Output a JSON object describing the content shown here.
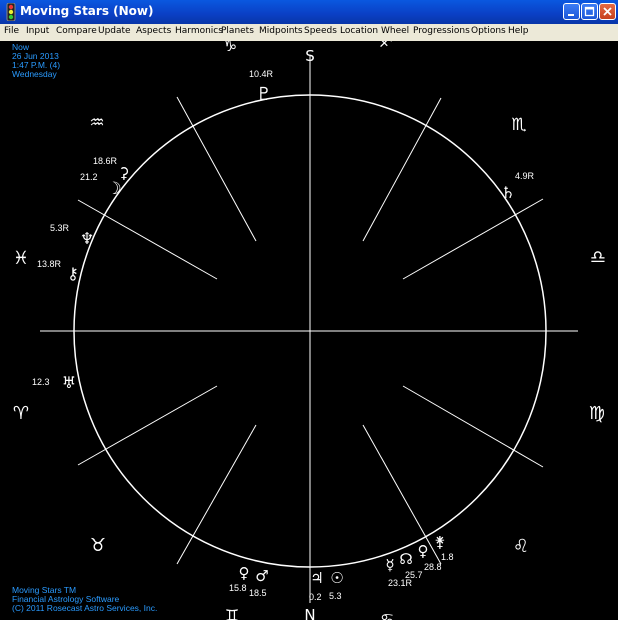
{
  "window": {
    "title": "Moving Stars (Now)"
  },
  "menu": [
    "File",
    "Input",
    "Compare",
    "Update",
    "Aspects",
    "Harmonics",
    "Planets",
    "Midpoints",
    "Speeds",
    "Location",
    "Wheel",
    "Progressions",
    "Options",
    "Help"
  ],
  "info_top": {
    "mode": "Now",
    "date": "26 Jun 2013",
    "time": "1:47 P.M. (4)",
    "weekday": "Wednesday"
  },
  "info_bottom": {
    "line1": "Moving Stars TM",
    "line2": "Financial Astrology Software",
    "line3": "(C) 2011 Rosecast Astro Services, Inc."
  },
  "directions": {
    "top": "S",
    "bottom": "N"
  },
  "signs": {
    "capricorn": "♑",
    "sagittarius": "♐",
    "aquarius": "♒",
    "scorpio": "♏",
    "pisces": "♓",
    "libra": "♎",
    "aries": "♈",
    "virgo": "♍",
    "taurus": "♉",
    "leo": "♌",
    "gemini": "♊",
    "cancer": "♋"
  },
  "planets": {
    "pluto": {
      "glyph": "♇",
      "value": "10.4R"
    },
    "saturn": {
      "glyph": "♄",
      "value": "4.9R"
    },
    "ceres": {
      "glyph": "⚳",
      "value": "18.6R"
    },
    "moon": {
      "glyph": "☽",
      "value": "21.2"
    },
    "neptune": {
      "glyph": "♆",
      "value": "5.3R"
    },
    "chiron": {
      "glyph": "⚷",
      "value": "13.8R"
    },
    "uranus": {
      "glyph": "♅",
      "value": "12.3"
    },
    "venus": {
      "glyph": "♀",
      "value": "15.8"
    },
    "mars": {
      "glyph": "♂",
      "value": "18.5"
    },
    "jupiter": {
      "glyph": "♃",
      "value": "0.2"
    },
    "sun": {
      "glyph": "☉",
      "value": "5.3"
    },
    "mercury": {
      "glyph": "☿",
      "value": "23.1R"
    },
    "node": {
      "glyph": "☊",
      "value": "25.7"
    },
    "venus2": {
      "glyph": "♀",
      "value": "28.8"
    },
    "juno": {
      "glyph": "⚵",
      "value": "1.8"
    }
  }
}
